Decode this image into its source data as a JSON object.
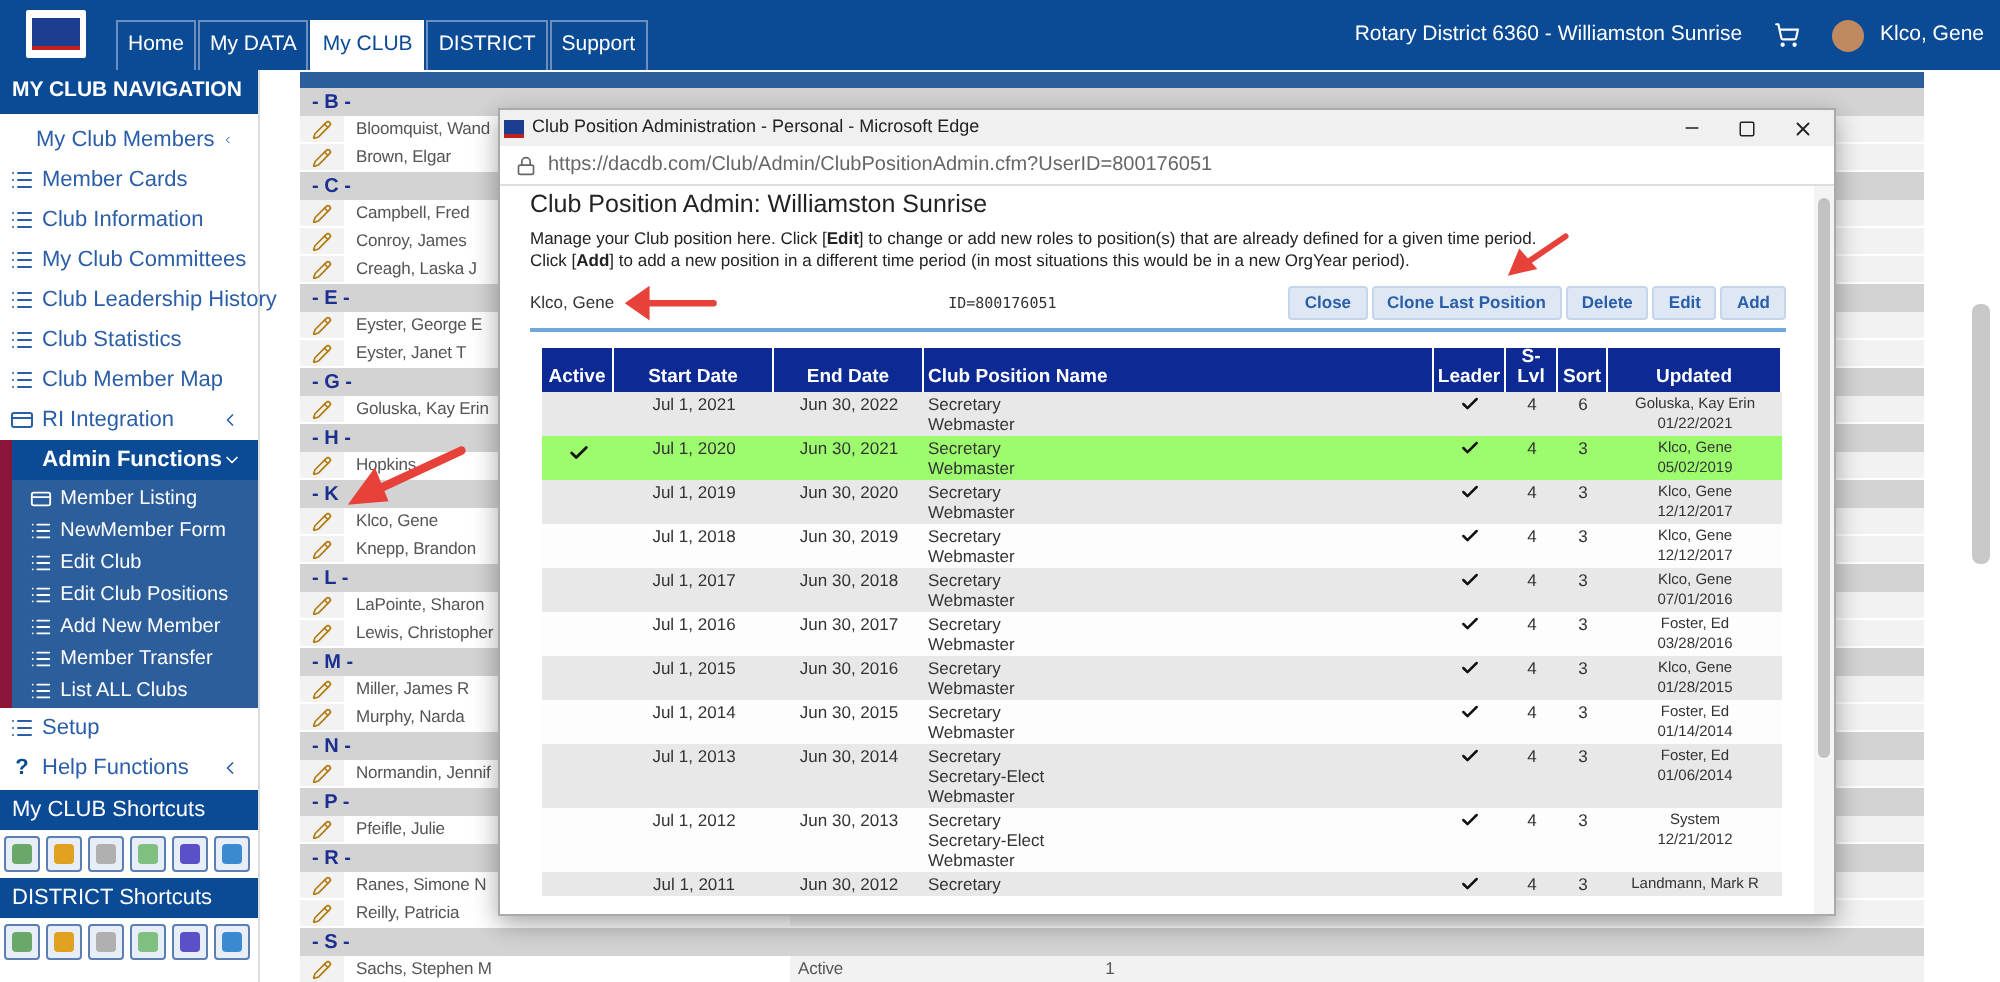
{
  "top_bar": {
    "tabs": [
      {
        "label": "Home",
        "selected": false
      },
      {
        "label": "My DATA",
        "selected": false
      },
      {
        "label": "My CLUB",
        "selected": true
      },
      {
        "label": "DISTRICT",
        "selected": false
      },
      {
        "label": "Support",
        "selected": false
      }
    ],
    "district": "Rotary District 6360 - Williamston Sunrise",
    "user": "Klco, Gene"
  },
  "sidebar": {
    "title": "MY CLUB NAVIGATION",
    "items": [
      {
        "label": "My Club Members",
        "kind": "collapsible"
      },
      {
        "label": "Member Cards",
        "kind": "list"
      },
      {
        "label": "Club Information",
        "kind": "list"
      },
      {
        "label": "My Club Committees",
        "kind": "list"
      },
      {
        "label": "Club Leadership History",
        "kind": "list"
      },
      {
        "label": "Club Statistics",
        "kind": "list"
      },
      {
        "label": "Club Member Map",
        "kind": "list"
      },
      {
        "label": "RI Integration",
        "kind": "card",
        "collapsible": true
      },
      {
        "label": "Admin Functions",
        "kind": "group",
        "expanded": true,
        "children": [
          {
            "label": "Member Listing",
            "kind": "card"
          },
          {
            "label": "NewMember Form",
            "kind": "list"
          },
          {
            "label": "Edit Club",
            "kind": "list"
          },
          {
            "label": "Edit Club Positions",
            "kind": "list"
          },
          {
            "label": "Add New Member",
            "kind": "list"
          },
          {
            "label": "Member Transfer",
            "kind": "list"
          },
          {
            "label": "List ALL Clubs",
            "kind": "list"
          }
        ]
      },
      {
        "label": "Setup",
        "kind": "list"
      },
      {
        "label": "Help Functions",
        "kind": "help",
        "icon": "?",
        "collapsible": true
      }
    ],
    "club_shortcuts": {
      "title": "My CLUB Shortcuts"
    },
    "district_shortcuts": {
      "title": "DISTRICT Shortcuts"
    }
  },
  "members": [
    {
      "kind": "letter",
      "text": "- B -"
    },
    {
      "kind": "member",
      "name": "Bloomquist, Wand"
    },
    {
      "kind": "member",
      "name": "Brown, Elgar"
    },
    {
      "kind": "letter",
      "text": "- C -"
    },
    {
      "kind": "member",
      "name": "Campbell, Fred"
    },
    {
      "kind": "member",
      "name": "Conroy, James"
    },
    {
      "kind": "member",
      "name": "Creagh, Laska J"
    },
    {
      "kind": "letter",
      "text": "- E -"
    },
    {
      "kind": "member",
      "name": "Eyster, George E"
    },
    {
      "kind": "member",
      "name": "Eyster, Janet T"
    },
    {
      "kind": "letter",
      "text": "- G -"
    },
    {
      "kind": "member",
      "name": "Goluska, Kay Erin"
    },
    {
      "kind": "letter",
      "text": "- H -"
    },
    {
      "kind": "member",
      "name": "Hopkins"
    },
    {
      "kind": "letter",
      "text": "- K"
    },
    {
      "kind": "member",
      "name": "Klco, Gene"
    },
    {
      "kind": "member",
      "name": "Knepp, Brandon"
    },
    {
      "kind": "letter",
      "text": "- L -"
    },
    {
      "kind": "member",
      "name": "LaPointe, Sharon"
    },
    {
      "kind": "member",
      "name": "Lewis, Christopher"
    },
    {
      "kind": "letter",
      "text": "- M -"
    },
    {
      "kind": "member",
      "name": "Miller, James R"
    },
    {
      "kind": "member",
      "name": "Murphy, Narda"
    },
    {
      "kind": "letter",
      "text": "- N -"
    },
    {
      "kind": "member",
      "name": "Normandin, Jennif"
    },
    {
      "kind": "letter",
      "text": "- P -"
    },
    {
      "kind": "member",
      "name": "Pfeifle, Julie"
    },
    {
      "kind": "letter",
      "text": "- R -"
    },
    {
      "kind": "member",
      "name": "Ranes, Simone N"
    },
    {
      "kind": "member",
      "name": "Reilly, Patricia"
    },
    {
      "kind": "letter",
      "text": "- S -"
    },
    {
      "kind": "member",
      "name": "Sachs, Stephen M",
      "status": "Active",
      "count": "1"
    }
  ],
  "dialog": {
    "title": "Club Position Administration - Personal - Microsoft Edge",
    "url": "https://dacdb.com/Club/Admin/ClubPositionAdmin.cfm?UserID=800176051",
    "heading": "Club Position Admin: Williamston Sunrise",
    "instructions": [
      "Manage your Club position here. Click [**Edit**] to change or add new roles to position(s) that are already defined for a given time period.",
      "Click [**Add**] to add a new position in a different time period (in most situations this would be in a new OrgYear period)."
    ],
    "member_name": "Klco, Gene",
    "member_id": "ID=800176051",
    "buttons": [
      "Close",
      "Clone Last Position",
      "Delete",
      "Edit",
      "Add"
    ],
    "table": {
      "columns": [
        "Active",
        "Start Date",
        "End Date",
        "Club Position Name",
        "Leader",
        "S-Lvl",
        "Sort",
        "Updated"
      ],
      "rows": [
        {
          "active": false,
          "start": "Jul 1, 2021",
          "end": "Jun 30, 2022",
          "positions": [
            "Secretary",
            "Webmaster"
          ],
          "leader": true,
          "s_lvl": "4",
          "sort": "6",
          "updated_by": "Goluska, Kay Erin",
          "updated_on": "01/22/2021"
        },
        {
          "active": true,
          "start": "Jul 1, 2020",
          "end": "Jun 30, 2021",
          "positions": [
            "Secretary",
            "Webmaster"
          ],
          "leader": true,
          "s_lvl": "4",
          "sort": "3",
          "updated_by": "Klco, Gene",
          "updated_on": "05/02/2019"
        },
        {
          "active": false,
          "start": "Jul 1, 2019",
          "end": "Jun 30, 2020",
          "positions": [
            "Secretary",
            "Webmaster"
          ],
          "leader": true,
          "s_lvl": "4",
          "sort": "3",
          "updated_by": "Klco, Gene",
          "updated_on": "12/12/2017"
        },
        {
          "active": false,
          "start": "Jul 1, 2018",
          "end": "Jun 30, 2019",
          "positions": [
            "Secretary",
            "Webmaster"
          ],
          "leader": true,
          "s_lvl": "4",
          "sort": "3",
          "updated_by": "Klco, Gene",
          "updated_on": "12/12/2017"
        },
        {
          "active": false,
          "start": "Jul 1, 2017",
          "end": "Jun 30, 2018",
          "positions": [
            "Secretary",
            "Webmaster"
          ],
          "leader": true,
          "s_lvl": "4",
          "sort": "3",
          "updated_by": "Klco, Gene",
          "updated_on": "07/01/2016"
        },
        {
          "active": false,
          "start": "Jul 1, 2016",
          "end": "Jun 30, 2017",
          "positions": [
            "Secretary",
            "Webmaster"
          ],
          "leader": true,
          "s_lvl": "4",
          "sort": "3",
          "updated_by": "Foster, Ed",
          "updated_on": "03/28/2016"
        },
        {
          "active": false,
          "start": "Jul 1, 2015",
          "end": "Jun 30, 2016",
          "positions": [
            "Secretary",
            "Webmaster"
          ],
          "leader": true,
          "s_lvl": "4",
          "sort": "3",
          "updated_by": "Klco, Gene",
          "updated_on": "01/28/2015"
        },
        {
          "active": false,
          "start": "Jul 1, 2014",
          "end": "Jun 30, 2015",
          "positions": [
            "Secretary",
            "Webmaster"
          ],
          "leader": true,
          "s_lvl": "4",
          "sort": "3",
          "updated_by": "Foster, Ed",
          "updated_on": "01/14/2014"
        },
        {
          "active": false,
          "start": "Jul 1, 2013",
          "end": "Jun 30, 2014",
          "positions": [
            "Secretary",
            "Secretary-Elect",
            "Webmaster"
          ],
          "leader": true,
          "s_lvl": "4",
          "sort": "3",
          "updated_by": "Foster, Ed",
          "updated_on": "01/06/2014"
        },
        {
          "active": false,
          "start": "Jul 1, 2012",
          "end": "Jun 30, 2013",
          "positions": [
            "Secretary",
            "Secretary-Elect",
            "Webmaster"
          ],
          "leader": true,
          "s_lvl": "4",
          "sort": "3",
          "updated_by": "System",
          "updated_on": "12/21/2012"
        },
        {
          "active": false,
          "start": "Jul 1, 2011",
          "end": "Jun 30, 2012",
          "positions": [
            "Secretary"
          ],
          "leader": true,
          "s_lvl": "4",
          "sort": "3",
          "updated_by": "Landmann, Mark R"
        }
      ]
    }
  }
}
